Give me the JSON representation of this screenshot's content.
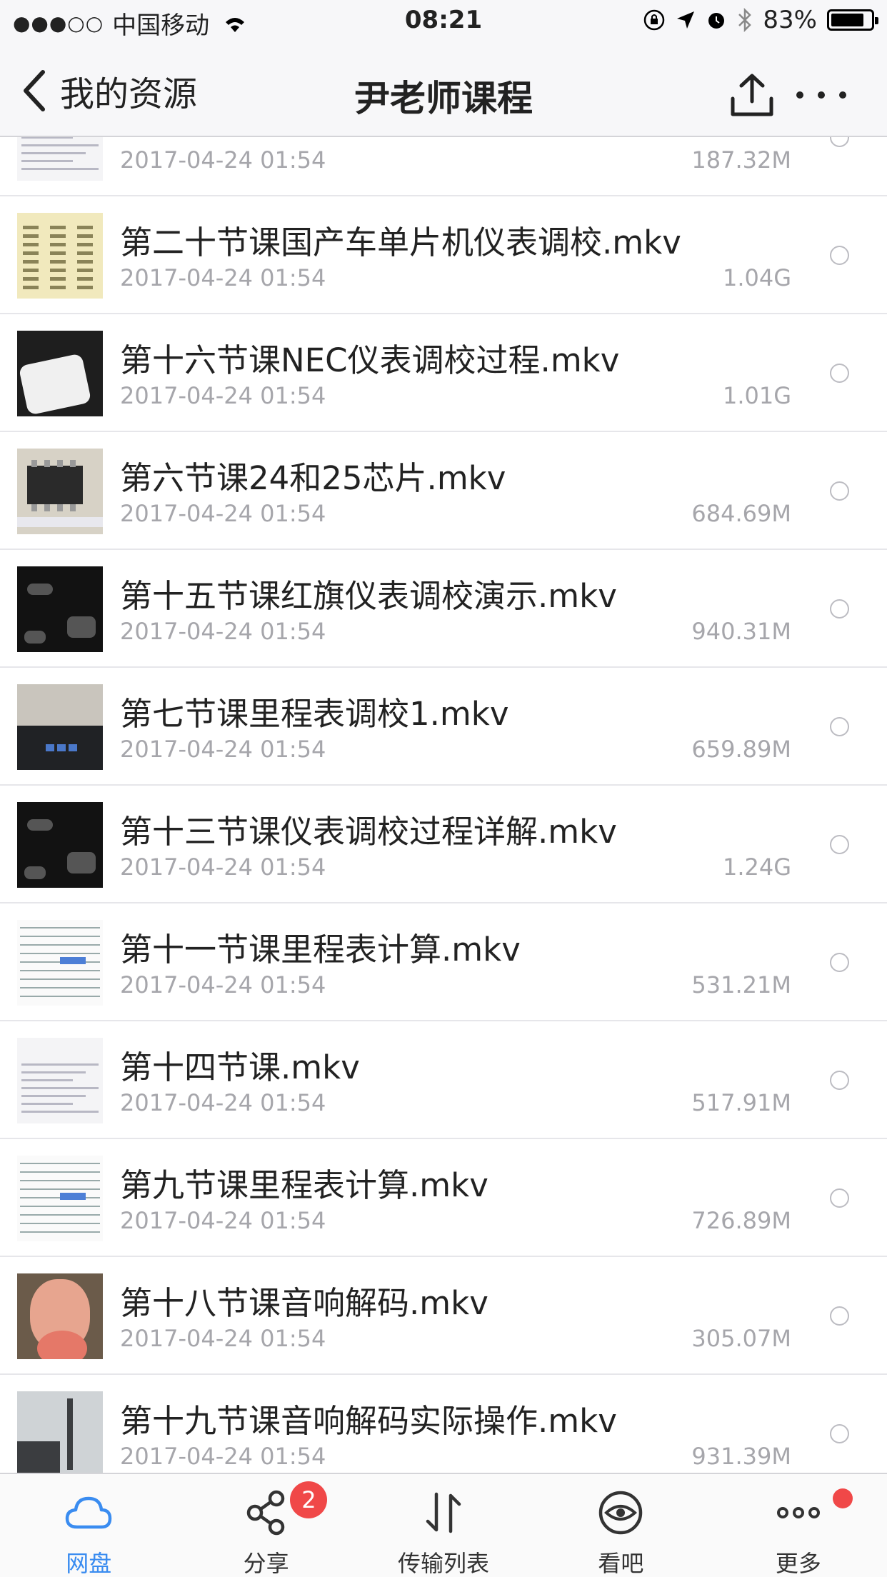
{
  "status_bar": {
    "signal": "●●●○○",
    "carrier": "中国移动",
    "time": "08:21",
    "battery": "83%",
    "battery_level": 0.83
  },
  "nav": {
    "back_label": "我的资源",
    "title": "尹老师课程"
  },
  "files": [
    {
      "name": "",
      "date": "2017-04-24 01:54",
      "size": "187.32M",
      "thumb": "doc"
    },
    {
      "name": "第二十节课国产车单片机仪表调校.mkv",
      "date": "2017-04-24 01:54",
      "size": "1.04G",
      "thumb": "yellow"
    },
    {
      "name": "第十六节课NEC仪表调校过程.mkv",
      "date": "2017-04-24 01:54",
      "size": "1.01G",
      "thumb": "white-led"
    },
    {
      "name": "第六节课24和25芯片.mkv",
      "date": "2017-04-24 01:54",
      "size": "684.69M",
      "thumb": "chip"
    },
    {
      "name": "第十五节课红旗仪表调校演示.mkv",
      "date": "2017-04-24 01:54",
      "size": "940.31M",
      "thumb": "dark"
    },
    {
      "name": "第七节课里程表调校1.mkv",
      "date": "2017-04-24 01:54",
      "size": "659.89M",
      "thumb": "keyboard"
    },
    {
      "name": "第十三节课仪表调校过程详解.mkv",
      "date": "2017-04-24 01:54",
      "size": "1.24G",
      "thumb": "dark"
    },
    {
      "name": "第十一节课里程表计算.mkv",
      "date": "2017-04-24 01:54",
      "size": "531.21M",
      "thumb": "sheet"
    },
    {
      "name": "第十四节课.mkv",
      "date": "2017-04-24 01:54",
      "size": "517.91M",
      "thumb": "doc"
    },
    {
      "name": "第九节课里程表计算.mkv",
      "date": "2017-04-24 01:54",
      "size": "726.89M",
      "thumb": "sheet"
    },
    {
      "name": "第十八节课音响解码.mkv",
      "date": "2017-04-24 01:54",
      "size": "305.07M",
      "thumb": "face"
    },
    {
      "name": "第十九节课音响解码实际操作.mkv",
      "date": "2017-04-24 01:54",
      "size": "931.39M",
      "thumb": "photo"
    }
  ],
  "tabs": [
    {
      "label": "网盘",
      "icon": "cloud-icon",
      "active": true
    },
    {
      "label": "分享",
      "icon": "share-icon",
      "badge": "2"
    },
    {
      "label": "传输列表",
      "icon": "transfer-icon"
    },
    {
      "label": "看吧",
      "icon": "eye-icon"
    },
    {
      "label": "更多",
      "icon": "more-icon",
      "dot": true
    }
  ],
  "colors": {
    "accent": "#3a8cf0",
    "badge": "#f04848",
    "secondary_text": "#a6a6ab"
  }
}
